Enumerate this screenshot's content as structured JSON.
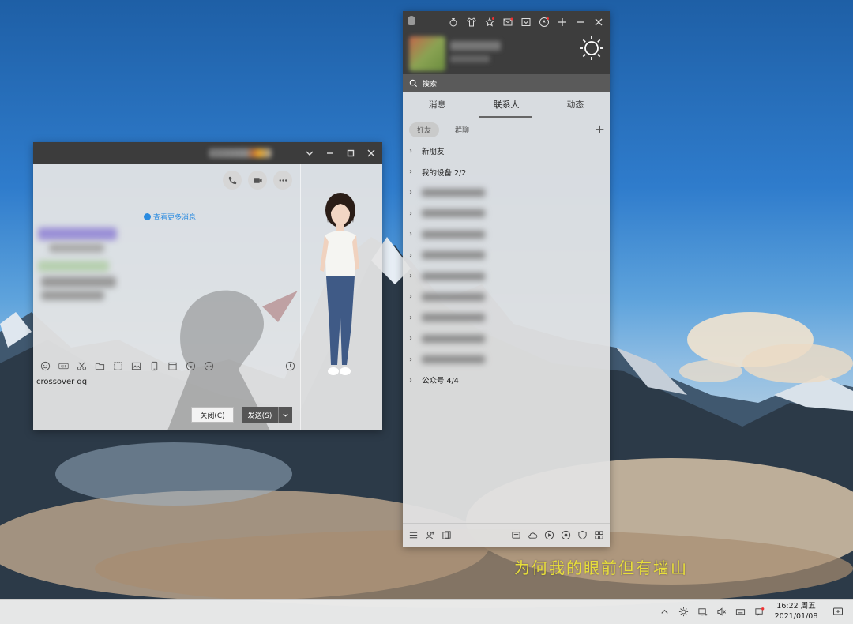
{
  "chat_window": {
    "view_more_messages": "查看更多消息",
    "input_text": "crossover  qq",
    "close_button": "关闭(C)",
    "send_button": "发送(S)",
    "toolbar_icons": [
      "emoji-icon",
      "gif-icon",
      "scissors-icon",
      "folder-icon",
      "screenshot-icon",
      "image-icon",
      "phone-icon",
      "calendar-icon",
      "music-icon",
      "more-icon",
      "history-clock-icon"
    ]
  },
  "contacts_window": {
    "search_placeholder": "搜索",
    "tabs": [
      {
        "label": "消息"
      },
      {
        "label": "联系人",
        "active": true
      },
      {
        "label": "动态"
      }
    ],
    "subtabs": [
      {
        "label": "好友",
        "active": true
      },
      {
        "label": "群聊"
      }
    ],
    "groups": [
      {
        "label": "新朋友"
      },
      {
        "label": "我的设备 2/2"
      },
      {
        "label": "公众号 4/4"
      }
    ]
  },
  "overlay_caption": "为何我的眼前但有墙山",
  "taskbar": {
    "time": "16:22 周五",
    "date": "2021/01/08"
  }
}
